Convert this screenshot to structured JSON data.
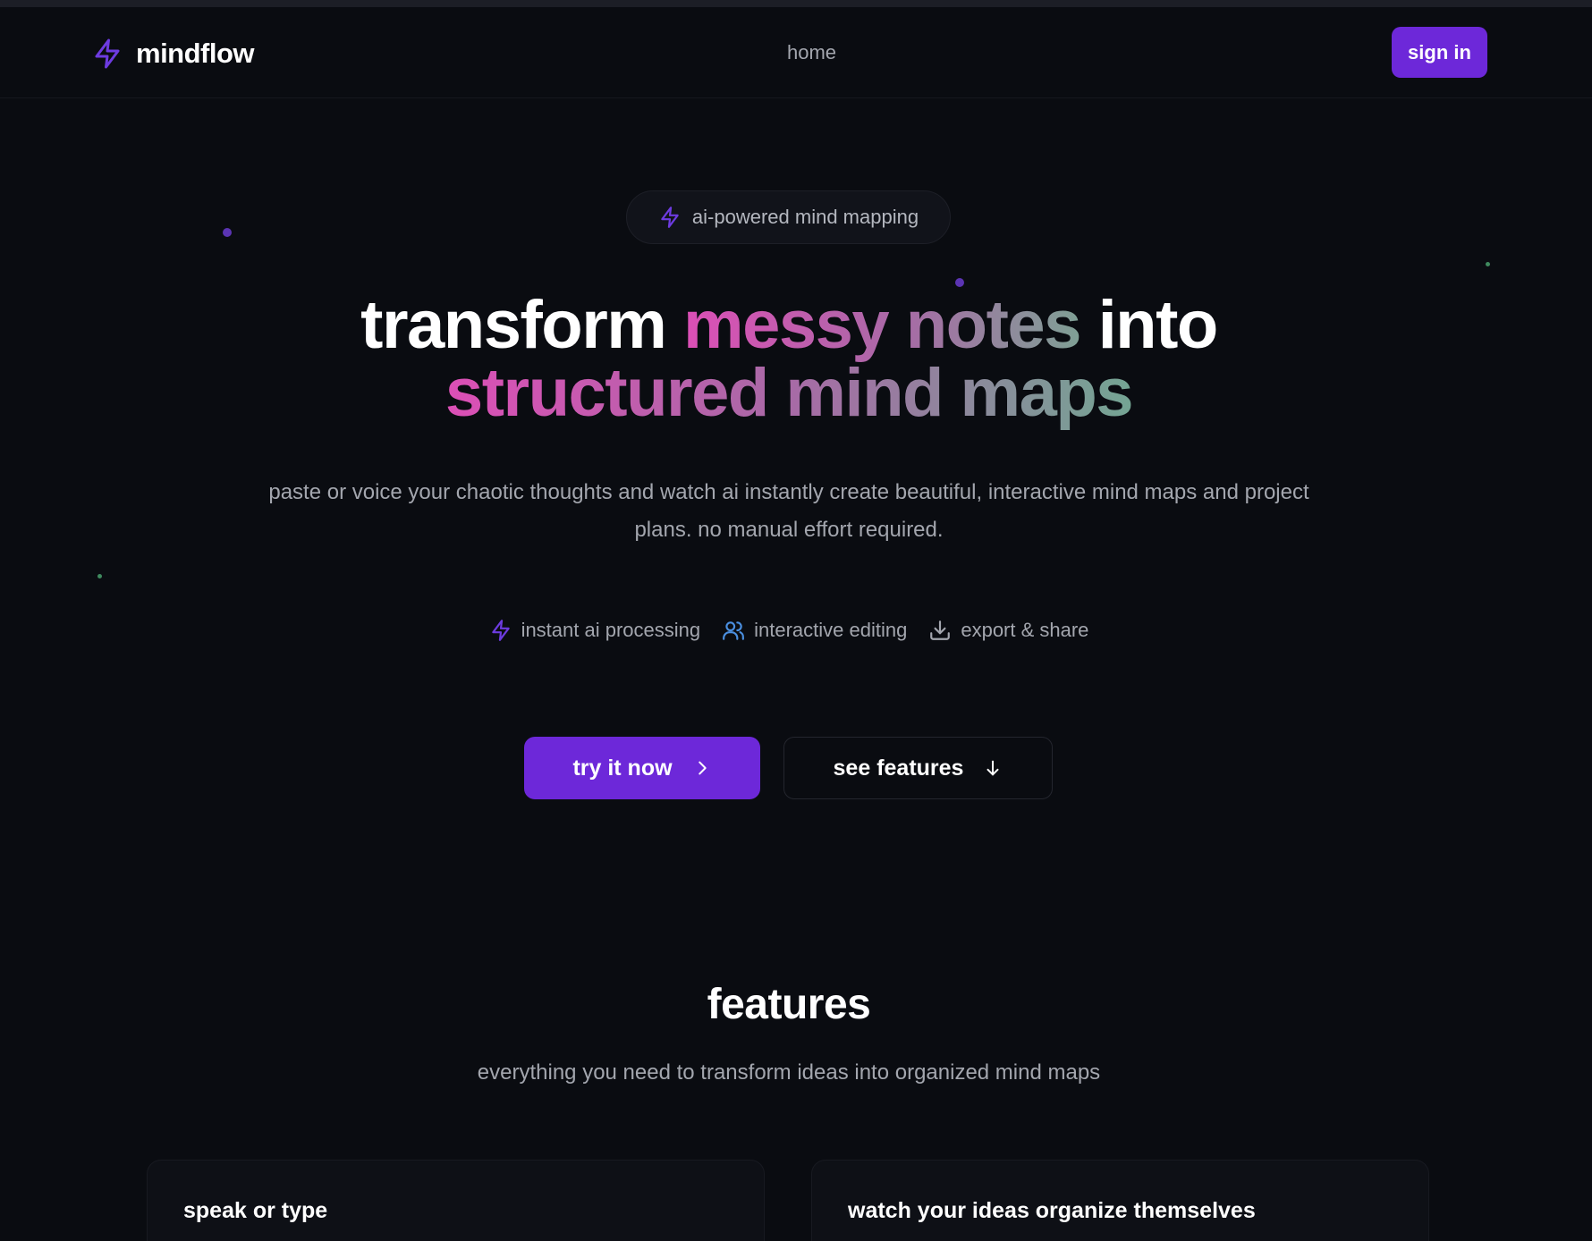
{
  "header": {
    "logo_text": "mindflow",
    "nav_home": "home",
    "sign_in": "sign in"
  },
  "hero": {
    "badge": "ai-powered mind mapping",
    "headline_part1": "transform ",
    "headline_highlight1": "messy notes",
    "headline_part2": " into",
    "headline_highlight2": "structured mind maps",
    "subtitle": "paste or voice your chaotic thoughts and watch ai instantly create beautiful, interactive mind maps and project plans. no manual effort required.",
    "highlights": [
      {
        "label": "instant ai processing",
        "icon": "lightning-icon"
      },
      {
        "label": "interactive editing",
        "icon": "users-icon"
      },
      {
        "label": "export & share",
        "icon": "download-icon"
      }
    ],
    "cta_primary": "try it now",
    "cta_secondary": "see features"
  },
  "features": {
    "title": "features",
    "subtitle": "everything you need to transform ideas into organized mind maps",
    "cards": [
      {
        "title": "speak or type"
      },
      {
        "title": "watch your ideas organize themselves"
      }
    ]
  },
  "colors": {
    "background": "#0a0c11",
    "accent": "#6d28d9",
    "gradient_start": "#dc4fb6",
    "gradient_end": "#74a593",
    "muted_text": "#a3a6ae"
  }
}
